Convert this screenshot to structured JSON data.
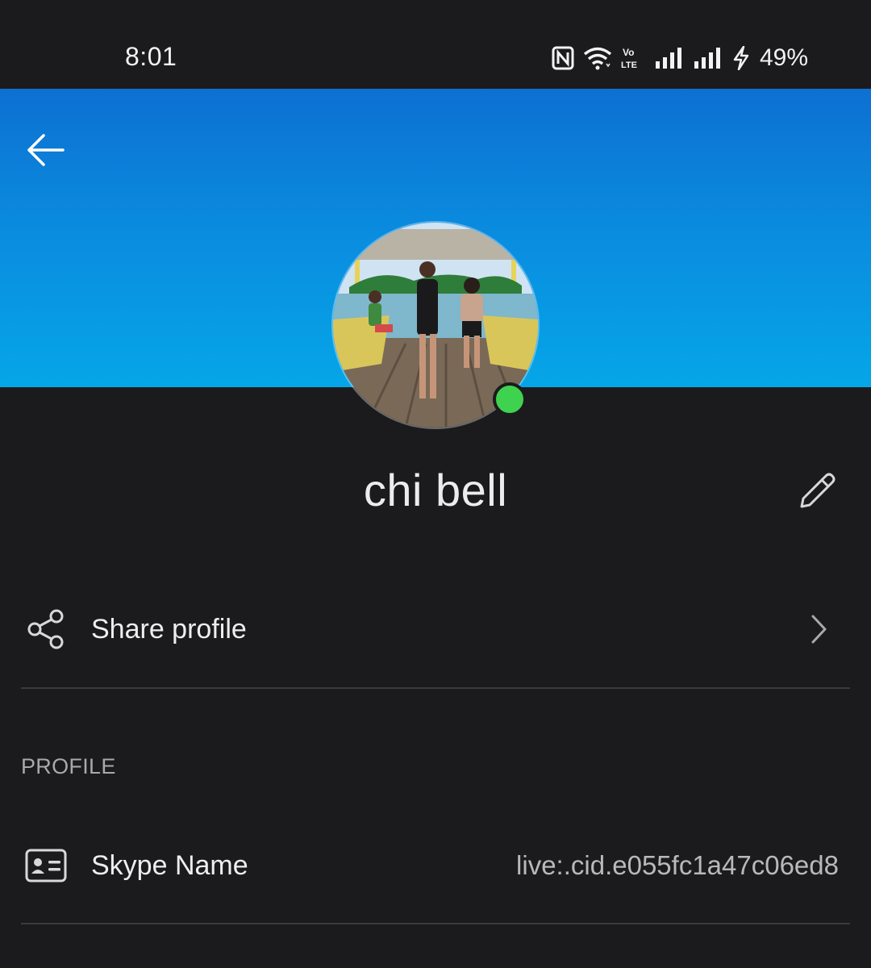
{
  "status_bar": {
    "time": "8:01",
    "battery": "49%",
    "icons": [
      "nfc-icon",
      "wifi-icon",
      "volte-icon",
      "signal-icon",
      "signal-icon",
      "charging-icon"
    ]
  },
  "header": {
    "back_icon": "arrow-left-icon",
    "banner_color_top": "#0d70d2",
    "banner_color_bottom": "#05a6e8"
  },
  "profile": {
    "name": "chi bell",
    "presence_color": "#3fd24f",
    "edit_icon": "pencil-icon"
  },
  "share_row": {
    "icon": "share-icon",
    "label": "Share profile",
    "chevron_icon": "chevron-right-icon"
  },
  "section": {
    "title": "PROFILE"
  },
  "skype_name_row": {
    "icon": "contact-card-icon",
    "label": "Skype Name",
    "value": "live:.cid.e055fc1a47c06ed8"
  }
}
